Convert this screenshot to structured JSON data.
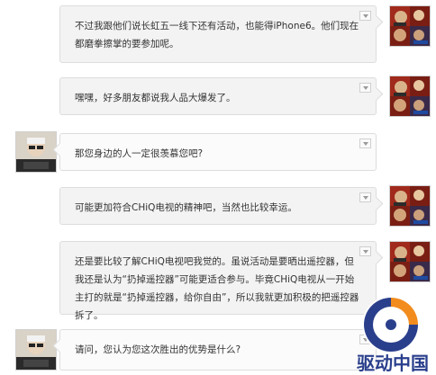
{
  "conversation": {
    "messages": [
      {
        "side": "right",
        "text": "不过我跟他们说长虹五一线下还有活动，也能得iPhone6。他们现在都磨拳擦掌的要参加呢。"
      },
      {
        "side": "right",
        "text": "嘿嘿，好多朋友都说我人品大爆发了。"
      },
      {
        "side": "left",
        "text": "那您身边的人一定很羡慕您吧?"
      },
      {
        "side": "right",
        "text": "可能更加符合CHiQ电视的精神吧，当然也比较幸运。"
      },
      {
        "side": "right",
        "text": "还是要比较了解CHiQ电视吧我觉的。虽说活动是要晒出遥控器，但我还是认为“扔掉遥控器”可能更适合参与。毕竟CHiQ电视从一开始主打的就是“扔掉遥控器，给你自由”，所以我就更加积极的把遥控器拆了。"
      },
      {
        "side": "left",
        "text": "请问，您认为您这次胜出的优势是什么?"
      }
    ]
  },
  "watermark": {
    "text": "驱动中国",
    "colors": {
      "blue": "#2a3f8c",
      "orange": "#f28c1e"
    }
  },
  "icons": {
    "bubble_menu": "chevron-down-icon",
    "right_avatar": "user-avatar-photo-icon",
    "left_avatar": "interviewer-avatar-photo-icon"
  }
}
